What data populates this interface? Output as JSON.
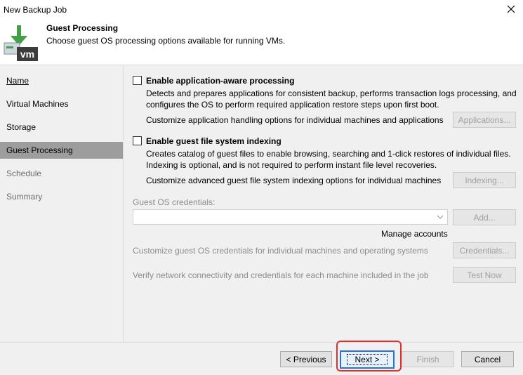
{
  "window": {
    "title": "New Backup Job"
  },
  "header": {
    "title": "Guest Processing",
    "subtitle": "Choose guest OS processing options available for running VMs.",
    "icon_text": "vm"
  },
  "sidebar": {
    "items": [
      {
        "label": "Name",
        "state": "done"
      },
      {
        "label": "Virtual Machines",
        "state": "done"
      },
      {
        "label": "Storage",
        "state": "done"
      },
      {
        "label": "Guest Processing",
        "state": "active"
      },
      {
        "label": "Schedule",
        "state": "disabled"
      },
      {
        "label": "Summary",
        "state": "disabled"
      }
    ]
  },
  "main": {
    "app_aware": {
      "label": "Enable application-aware processing",
      "checked": false,
      "desc_line1": "Detects and prepares applications for consistent backup, performs transaction logs processing, and",
      "desc_line2": "configures the OS to perform required application restore steps upon first boot.",
      "customize": "Customize application handling options for individual machines and applications",
      "button": "Applications..."
    },
    "indexing": {
      "label": "Enable guest file system indexing",
      "checked": false,
      "desc_line1": "Creates catalog of guest files to enable browsing, searching and 1-click restores of individual files.",
      "desc_line2": "Indexing is optional, and is not required to perform instant file level recoveries.",
      "customize": "Customize advanced guest file system indexing options for individual machines",
      "button": "Indexing..."
    },
    "credentials": {
      "label": "Guest OS credentials:",
      "value": "",
      "add_button": "Add...",
      "manage_accounts": "Manage accounts",
      "customize": "Customize guest OS credentials for individual machines and operating systems",
      "customize_button": "Credentials...",
      "verify": "Verify network connectivity and credentials for each machine included in the job",
      "test_button": "Test Now"
    }
  },
  "footer": {
    "previous": "< Previous",
    "next": "Next >",
    "finish": "Finish",
    "cancel": "Cancel"
  },
  "colors": {
    "highlight": "#e0312f",
    "primary_border": "#2a71d0",
    "active_item": "#9d9d9d",
    "icon_green": "#4caf50"
  }
}
